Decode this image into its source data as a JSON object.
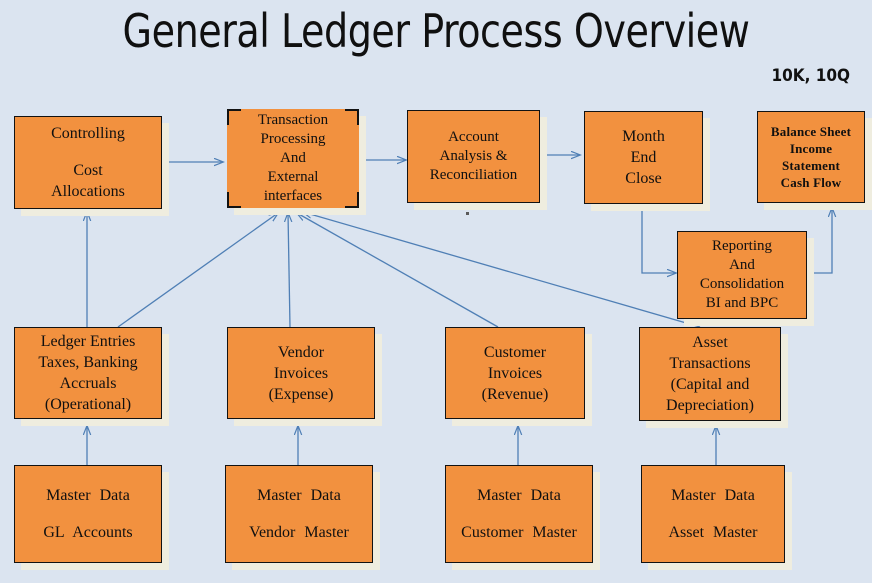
{
  "page": {
    "title": "General Ledger Process Overview",
    "corner_note": "10K, 10Q",
    "background_color": "#dbe4f0",
    "box_color": "#f2913f",
    "box_border_color": "#121212",
    "box_shadow_color": "#efeddf",
    "arrow_color": "#4f7fb5"
  },
  "nodes": {
    "controlling": {
      "line1": "Controlling",
      "line2": "Cost",
      "line3": "Allocations"
    },
    "transaction_processing": {
      "line1": "Transaction",
      "line2": "Processing",
      "line3": "And",
      "line4": "External",
      "line5": "interfaces"
    },
    "account_analysis": {
      "line1": "Account",
      "line2": "Analysis  &",
      "line3": "Reconciliation"
    },
    "month_end_close": {
      "line1": "Month",
      "line2": "End",
      "line3": "Close"
    },
    "financial_statements": {
      "line1": "Balance Sheet",
      "line2": "Income",
      "line3": "Statement",
      "line4": "Cash Flow"
    },
    "reporting_consolidation": {
      "line1": "Reporting",
      "line2": "And",
      "line3": "Consolidation",
      "line4": "BI and  BPC"
    },
    "ledger_entries": {
      "line1": "Ledger Entries",
      "line2": "Taxes, Banking",
      "line3": "Accruals",
      "line4": "(Operational)"
    },
    "vendor_invoices": {
      "line1": "Vendor",
      "line2": "Invoices",
      "line3": "(Expense)"
    },
    "customer_invoices": {
      "line1": "Customer",
      "line2": "Invoices",
      "line3": "(Revenue)"
    },
    "asset_transactions": {
      "line1": "Asset",
      "line2": "Transactions",
      "line3": "(Capital and",
      "line4": "Depreciation)"
    },
    "master_data_gl": {
      "line1": "Master  Data",
      "line2": "GL  Accounts"
    },
    "master_data_vendor": {
      "line1": "Master  Data",
      "line2": "Vendor  Master"
    },
    "master_data_customer": {
      "line1": "Master  Data",
      "line2": "Customer  Master"
    },
    "master_data_asset": {
      "line1": "Master  Data",
      "line2": "Asset Master"
    }
  }
}
